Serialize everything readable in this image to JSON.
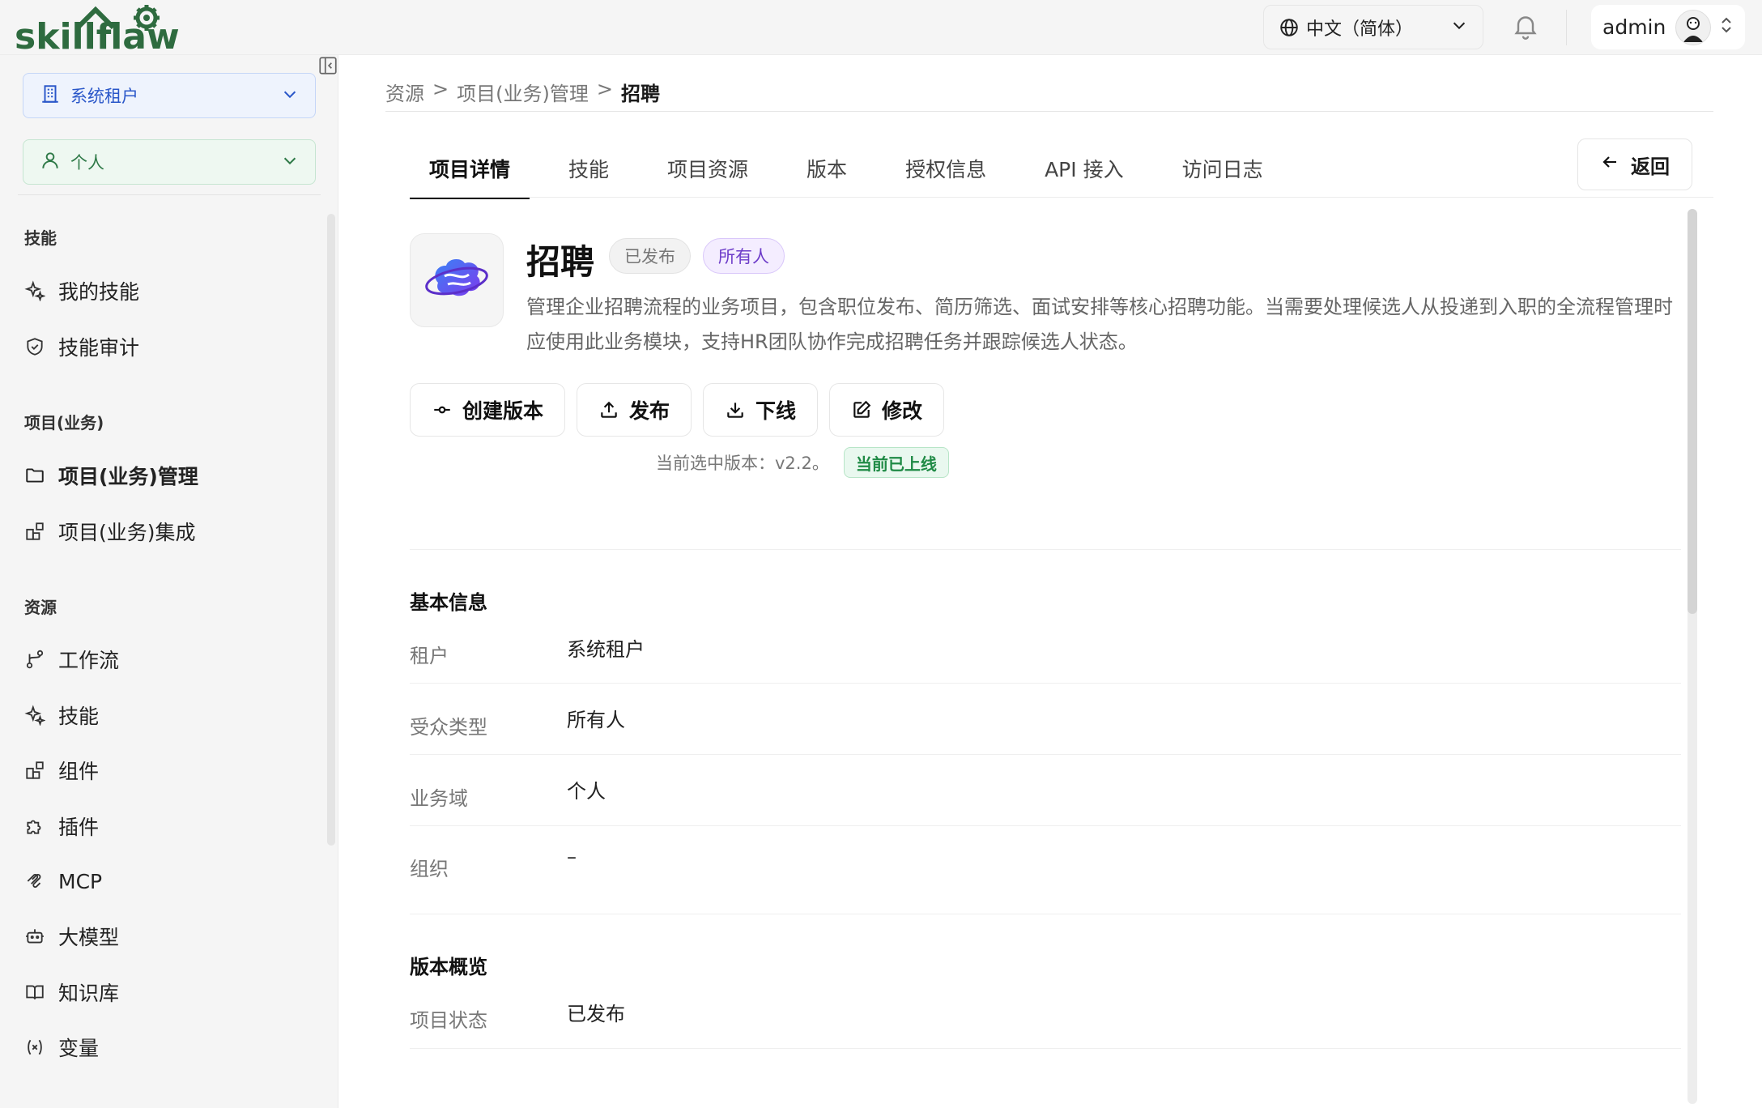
{
  "header": {
    "logo_text": "skillflaw",
    "language": "中文（简体）",
    "user_name": "admin"
  },
  "sidebar": {
    "tenant": "系统租户",
    "domain": "个人",
    "sections": [
      {
        "title": "技能",
        "items": [
          {
            "label": "我的技能",
            "icon": "sparkle-icon"
          },
          {
            "label": "技能审计",
            "icon": "shield-icon"
          }
        ]
      },
      {
        "title": "项目(业务)",
        "items": [
          {
            "label": "项目(业务)管理",
            "icon": "folder-icon",
            "active": true
          },
          {
            "label": "项目(业务)集成",
            "icon": "blocks-icon"
          }
        ]
      },
      {
        "title": "资源",
        "items": [
          {
            "label": "工作流",
            "icon": "workflow-icon"
          },
          {
            "label": "技能",
            "icon": "sparkle-icon"
          },
          {
            "label": "组件",
            "icon": "blocks-icon"
          },
          {
            "label": "插件",
            "icon": "puzzle-icon"
          },
          {
            "label": "MCP",
            "icon": "mcp-icon"
          },
          {
            "label": "大模型",
            "icon": "robot-icon"
          },
          {
            "label": "知识库",
            "icon": "book-icon"
          },
          {
            "label": "变量",
            "icon": "variable-icon"
          }
        ]
      }
    ]
  },
  "breadcrumb": {
    "items": [
      "资源",
      "项目(业务)管理",
      "招聘"
    ],
    "separator": ">"
  },
  "tabs": [
    "项目详情",
    "技能",
    "项目资源",
    "版本",
    "授权信息",
    "API 接入",
    "访问日志"
  ],
  "active_tab": 0,
  "back_label": "返回",
  "project": {
    "name": "招聘",
    "status_badge": "已发布",
    "audience_badge": "所有人",
    "description": "管理企业招聘流程的业务项目，包含职位发布、简历筛选、面试安排等核心招聘功能。当需要处理候选人从投递到入职的全流程管理时应使用此业务模块，支持HR团队协作完成招聘任务并跟踪候选人状态。"
  },
  "actions": {
    "create_version": "创建版本",
    "publish": "发布",
    "offline": "下线",
    "edit": "修改"
  },
  "version_info": {
    "text": "当前选中版本：v2.2。",
    "online_badge": "当前已上线"
  },
  "basic_info": {
    "title": "基本信息",
    "rows": [
      {
        "label": "租户",
        "value": "系统租户"
      },
      {
        "label": "受众类型",
        "value": "所有人"
      },
      {
        "label": "业务域",
        "value": "个人"
      },
      {
        "label": "组织",
        "value": "–"
      }
    ]
  },
  "version_overview": {
    "title": "版本概览",
    "rows": [
      {
        "label": "项目状态",
        "value": "已发布"
      }
    ]
  },
  "colors": {
    "tenant_blue": "#2a57c9",
    "domain_green": "#2f7a48",
    "logo_green": "#2e6b3f",
    "audience_purple": "#6d3cc9",
    "online_green": "#1f8a45"
  }
}
